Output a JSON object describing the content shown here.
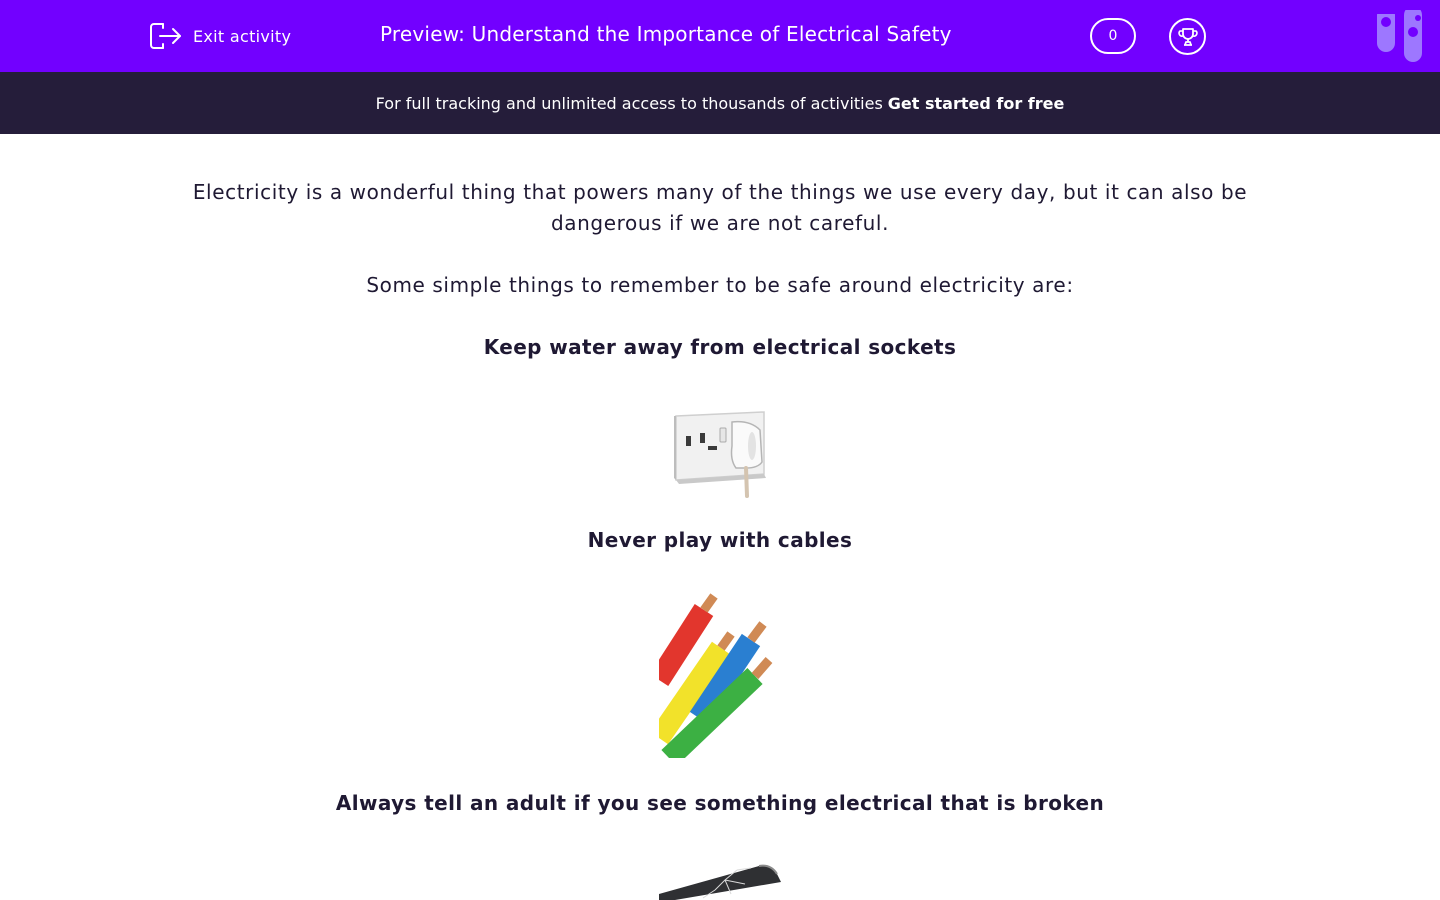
{
  "header": {
    "exit_label": "Exit activity",
    "title": "Preview: Understand the Importance of Electrical Safety",
    "score": "0",
    "brand_color": "#7200ff"
  },
  "banner": {
    "text": "For full tracking and unlimited access to thousands of activities",
    "link": "Get started for free",
    "background": "#251d3a"
  },
  "content": {
    "intro": "Electricity is a wonderful thing that powers many of the things we use every day, but it can also be dangerous if we are not careful.",
    "lead": "Some simple things to remember to be safe around electricity are:",
    "tips": [
      {
        "heading": "Keep water away from electrical sockets",
        "image": "plug-socket-image"
      },
      {
        "heading": "Never play with cables",
        "image": "cables-image"
      },
      {
        "heading": "Always tell an adult if you see something electrical that is broken",
        "image": "broken-phone-image"
      }
    ]
  },
  "icons": {
    "exit": "exit-door-icon",
    "trophy": "trophy-icon",
    "logo": "edplace-logo"
  }
}
